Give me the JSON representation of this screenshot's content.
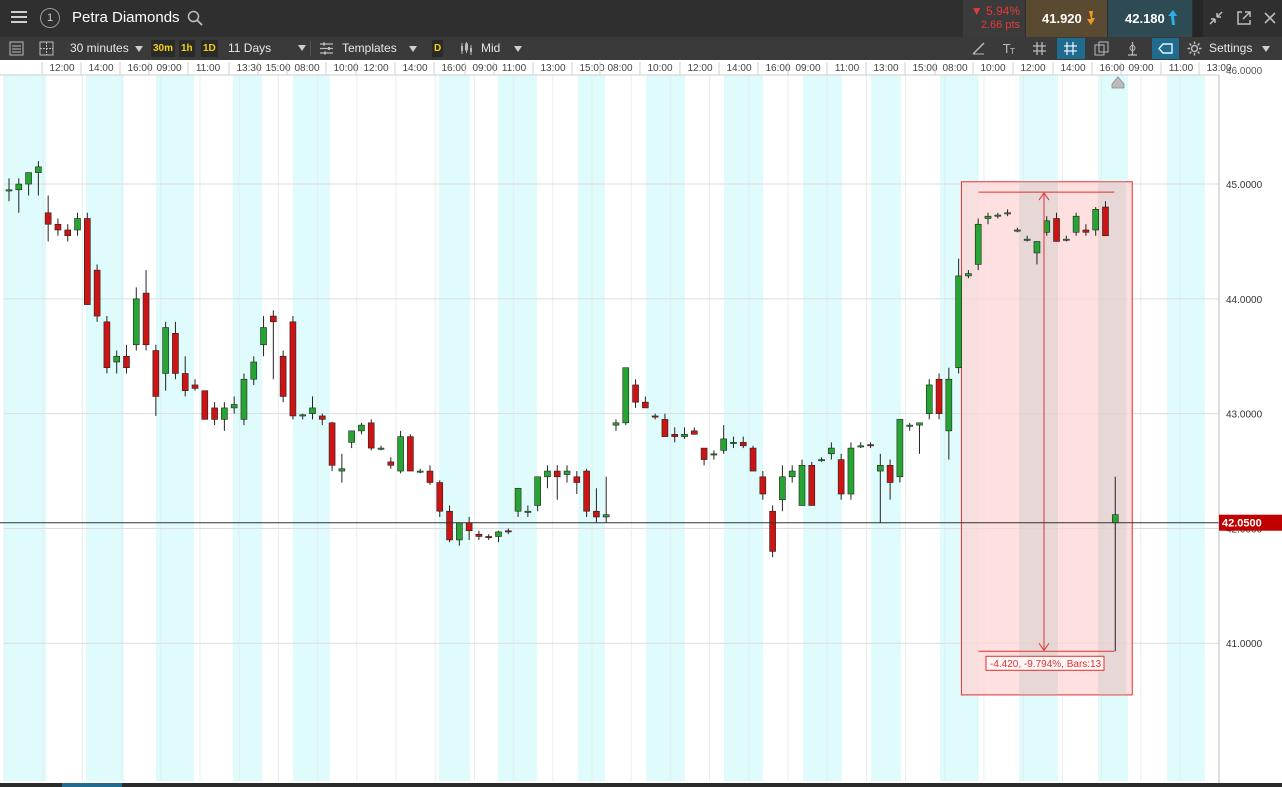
{
  "header": {
    "menu_icon": "hamburger-icon",
    "account_badge": "1",
    "instrument_name": "Petra Diamonds",
    "change_percent": "▼ 5.94%",
    "change_points": "2.66 pts",
    "sell_price": "41.920",
    "buy_price": "42.180"
  },
  "toolbar": {
    "interval": "30 minutes",
    "quick_intervals": [
      "30m",
      "1h",
      "1D"
    ],
    "range": "11 Days",
    "templates": "Templates",
    "daily_badge": "D",
    "price_mode": "Mid",
    "settings": "Settings"
  },
  "colors": {
    "up": "#27a532",
    "down": "#cc1414",
    "session_shade": "#dffbfb",
    "measure_fill": "#ffd6d6",
    "measure_stroke": "#e03030",
    "price_tag": "#c00000"
  },
  "chart_data": {
    "type": "candlestick",
    "time_labels": [
      "12:00",
      "14:00",
      "16:00",
      "09:00",
      "11:00",
      "13:30",
      "15:00",
      "08:00",
      "10:00",
      "12:00",
      "14:00",
      "16:00",
      "09:00",
      "11:00",
      "13:00",
      "15:00",
      "08:00",
      "10:00",
      "12:00",
      "14:00",
      "16:00",
      "09:00",
      "11:00",
      "13:00",
      "15:00",
      "08:00",
      "10:00",
      "12:00",
      "14:00",
      "16:00",
      "09:00",
      "11:00",
      "13:00"
    ],
    "y_ticks": [
      41.0,
      42.0,
      43.0,
      44.0,
      45.0
    ],
    "y_tick_labels": [
      "41.0000",
      "42.0000",
      "43.0000",
      "44.0000",
      "45.0000"
    ],
    "top_cut_label": "46.0000",
    "ylim": [
      39.8,
      45.95
    ],
    "current_price": 42.05,
    "current_price_label": "42.0500",
    "measure": {
      "label": "-4.420, -9.794%, Bars:13",
      "from": 44.93,
      "to": 40.93
    },
    "candles": [
      [
        44.95,
        45.05,
        44.85,
        44.95
      ],
      [
        44.95,
        45.05,
        44.75,
        45.0
      ],
      [
        45.0,
        45.1,
        44.9,
        45.1
      ],
      [
        45.1,
        45.2,
        44.9,
        45.15
      ],
      [
        44.75,
        44.9,
        44.5,
        44.65
      ],
      [
        44.65,
        44.7,
        44.55,
        44.6
      ],
      [
        44.6,
        44.65,
        44.5,
        44.55
      ],
      [
        44.6,
        44.75,
        44.55,
        44.7
      ],
      [
        44.7,
        44.75,
        43.95,
        43.95
      ],
      [
        44.25,
        44.3,
        43.8,
        43.85
      ],
      [
        43.8,
        43.85,
        43.35,
        43.4
      ],
      [
        43.45,
        43.55,
        43.35,
        43.5
      ],
      [
        43.5,
        43.6,
        43.35,
        43.4
      ],
      [
        43.6,
        44.1,
        43.55,
        44.0
      ],
      [
        44.05,
        44.25,
        43.55,
        43.6
      ],
      [
        43.55,
        43.6,
        42.98,
        43.15
      ],
      [
        43.35,
        43.8,
        43.2,
        43.75
      ],
      [
        43.7,
        43.8,
        43.3,
        43.35
      ],
      [
        43.35,
        43.5,
        43.15,
        43.2
      ],
      [
        43.25,
        43.3,
        43.2,
        43.22
      ],
      [
        43.2,
        43.2,
        42.95,
        42.95
      ],
      [
        43.05,
        43.1,
        42.9,
        42.95
      ],
      [
        42.95,
        43.1,
        42.85,
        43.05
      ],
      [
        43.05,
        43.15,
        43.0,
        43.08
      ],
      [
        42.95,
        43.35,
        42.9,
        43.3
      ],
      [
        43.3,
        43.5,
        43.25,
        43.45
      ],
      [
        43.6,
        43.85,
        43.5,
        43.75
      ],
      [
        43.85,
        43.9,
        43.3,
        43.8
      ],
      [
        43.5,
        43.55,
        43.1,
        43.15
      ],
      [
        43.8,
        43.85,
        42.95,
        42.98
      ],
      [
        42.98,
        43.0,
        42.95,
        42.99
      ],
      [
        43.0,
        43.15,
        42.95,
        43.05
      ],
      [
        42.98,
        43.0,
        42.9,
        42.95
      ],
      [
        42.92,
        42.93,
        42.5,
        42.55
      ],
      [
        42.5,
        42.65,
        42.4,
        42.52
      ],
      [
        42.75,
        42.85,
        42.7,
        42.85
      ],
      [
        42.85,
        42.92,
        42.82,
        42.9
      ],
      [
        42.92,
        42.95,
        42.68,
        42.7
      ],
      [
        42.7,
        42.72,
        42.68,
        42.7
      ],
      [
        42.58,
        42.62,
        42.52,
        42.55
      ],
      [
        42.5,
        42.85,
        42.48,
        42.8
      ],
      [
        42.8,
        42.82,
        42.5,
        42.5
      ],
      [
        42.5,
        42.52,
        42.48,
        42.5
      ],
      [
        42.5,
        42.55,
        42.38,
        42.4
      ],
      [
        42.4,
        42.42,
        42.1,
        42.15
      ],
      [
        42.15,
        42.2,
        41.88,
        41.9
      ],
      [
        41.9,
        42.05,
        41.85,
        42.05
      ],
      [
        42.05,
        42.1,
        41.9,
        41.98
      ],
      [
        41.95,
        41.98,
        41.9,
        41.93
      ],
      [
        41.93,
        41.95,
        41.9,
        41.92
      ],
      [
        41.93,
        41.98,
        41.88,
        41.97
      ],
      [
        41.98,
        42.0,
        41.95,
        41.97
      ],
      [
        42.15,
        42.35,
        42.1,
        42.35
      ],
      [
        42.15,
        42.2,
        42.1,
        42.15
      ],
      [
        42.2,
        42.35,
        42.15,
        42.45
      ],
      [
        42.45,
        42.55,
        42.35,
        42.5
      ],
      [
        42.5,
        42.55,
        42.25,
        42.45
      ],
      [
        42.47,
        42.55,
        42.4,
        42.5
      ],
      [
        42.45,
        42.5,
        42.3,
        42.4
      ],
      [
        42.5,
        42.52,
        42.1,
        42.15
      ],
      [
        42.15,
        42.35,
        42.05,
        42.1
      ],
      [
        42.1,
        42.45,
        42.05,
        42.12
      ],
      [
        42.9,
        42.95,
        42.85,
        42.92
      ],
      [
        42.92,
        43.4,
        42.9,
        43.4
      ],
      [
        43.25,
        43.3,
        43.05,
        43.1
      ],
      [
        43.1,
        43.15,
        43.05,
        43.05
      ],
      [
        42.98,
        43.0,
        42.95,
        42.97
      ],
      [
        42.95,
        43.0,
        42.8,
        42.8
      ],
      [
        42.82,
        42.88,
        42.75,
        42.8
      ],
      [
        42.8,
        42.88,
        42.78,
        42.82
      ],
      [
        42.85,
        42.88,
        42.82,
        42.82
      ],
      [
        42.7,
        42.7,
        42.55,
        42.6
      ],
      [
        42.65,
        42.68,
        42.6,
        42.65
      ],
      [
        42.68,
        42.9,
        42.65,
        42.78
      ],
      [
        42.75,
        42.8,
        42.7,
        42.75
      ],
      [
        42.75,
        42.8,
        42.7,
        42.72
      ],
      [
        42.7,
        42.72,
        42.55,
        42.5
      ],
      [
        42.45,
        42.5,
        42.25,
        42.3
      ],
      [
        42.15,
        42.2,
        41.75,
        41.8
      ],
      [
        42.25,
        42.55,
        42.15,
        42.45
      ],
      [
        42.45,
        42.55,
        42.4,
        42.5
      ],
      [
        42.2,
        42.6,
        42.2,
        42.55
      ],
      [
        42.55,
        42.58,
        42.2,
        42.2
      ],
      [
        42.6,
        42.62,
        42.58,
        42.6
      ],
      [
        42.65,
        42.75,
        42.6,
        42.7
      ],
      [
        42.6,
        42.65,
        42.25,
        42.3
      ],
      [
        42.3,
        42.75,
        42.25,
        42.7
      ],
      [
        42.72,
        42.75,
        42.7,
        42.72
      ],
      [
        42.73,
        42.75,
        42.7,
        42.72
      ],
      [
        42.5,
        42.65,
        42.05,
        42.55
      ],
      [
        42.55,
        42.6,
        42.25,
        42.4
      ],
      [
        42.45,
        42.95,
        42.4,
        42.95
      ],
      [
        42.9,
        42.92,
        42.85,
        42.9
      ],
      [
        42.9,
        42.92,
        42.65,
        42.92
      ],
      [
        43.0,
        43.3,
        42.95,
        43.25
      ],
      [
        43.3,
        43.35,
        42.95,
        43.0
      ],
      [
        42.85,
        43.4,
        42.6,
        43.3
      ],
      [
        43.4,
        44.35,
        43.35,
        44.2
      ],
      [
        44.2,
        44.25,
        44.18,
        44.22
      ],
      [
        44.3,
        44.7,
        44.25,
        44.65
      ],
      [
        44.7,
        44.75,
        44.65,
        44.72
      ],
      [
        44.72,
        44.75,
        44.7,
        44.73
      ],
      [
        44.75,
        44.78,
        44.72,
        44.75
      ],
      [
        44.6,
        44.62,
        44.58,
        44.6
      ],
      [
        44.52,
        44.55,
        44.5,
        44.52
      ],
      [
        44.4,
        44.48,
        44.3,
        44.5
      ],
      [
        44.58,
        44.72,
        44.55,
        44.68
      ],
      [
        44.7,
        44.75,
        44.5,
        44.5
      ],
      [
        44.52,
        44.55,
        44.5,
        44.52
      ],
      [
        44.58,
        44.75,
        44.55,
        44.72
      ],
      [
        44.6,
        44.65,
        44.55,
        44.58
      ],
      [
        44.6,
        44.8,
        44.55,
        44.78
      ],
      [
        44.8,
        44.85,
        44.55,
        44.55
      ],
      [
        42.05,
        42.45,
        40.93,
        42.12
      ]
    ]
  }
}
